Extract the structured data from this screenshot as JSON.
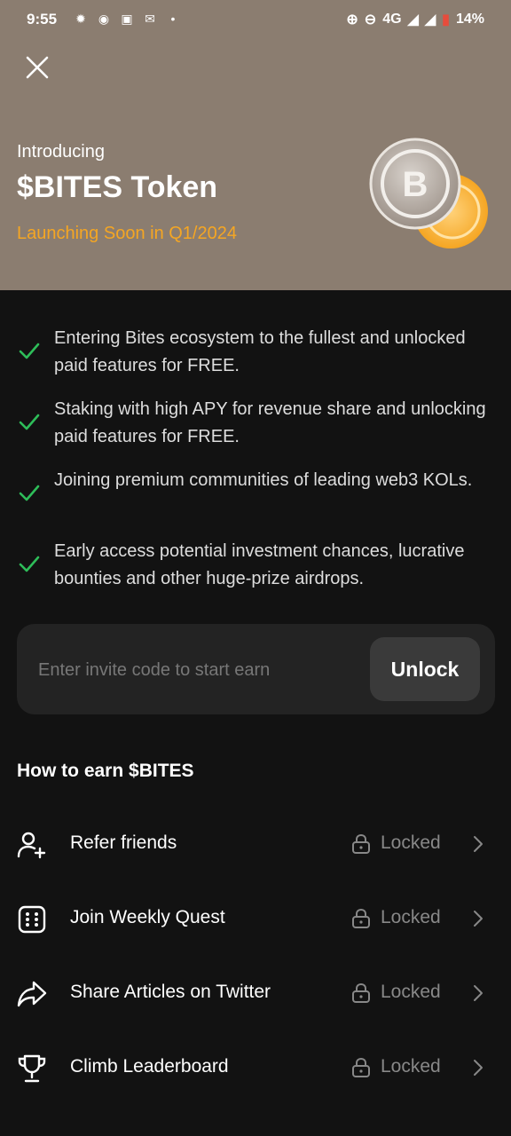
{
  "status_bar": {
    "time": "9:55",
    "network": "4G",
    "battery": "14%"
  },
  "hero": {
    "intro": "Introducing",
    "title": "$BITES Token",
    "launch": "Launching Soon in Q1/2024",
    "coin_letter": "B",
    "accent_color": "#f5a623"
  },
  "features": [
    {
      "text": "Entering Bites ecosystem to the fullest and unlocked paid features for FREE."
    },
    {
      "text": "Staking with high APY for revenue share and unlocking paid features for FREE."
    },
    {
      "text": "Joining premium communities of leading web3 KOLs."
    },
    {
      "text": "Early access potential investment chances, lucrative bounties and other huge-prize airdrops."
    }
  ],
  "invite": {
    "placeholder": "Enter invite code to start earn",
    "button_label": "Unlock"
  },
  "earn": {
    "title": "How to earn $BITES",
    "items": [
      {
        "label": "Refer friends",
        "status": "Locked",
        "icon": "add-user-icon"
      },
      {
        "label": "Join Weekly Quest",
        "status": "Locked",
        "icon": "dice-icon"
      },
      {
        "label": "Share Articles on Twitter",
        "status": "Locked",
        "icon": "share-icon"
      },
      {
        "label": "Climb Leaderboard",
        "status": "Locked",
        "icon": "trophy-icon"
      }
    ]
  },
  "colors": {
    "hero_bg": "#8b7d70",
    "page_bg": "#121212",
    "check": "#2ebd59"
  }
}
